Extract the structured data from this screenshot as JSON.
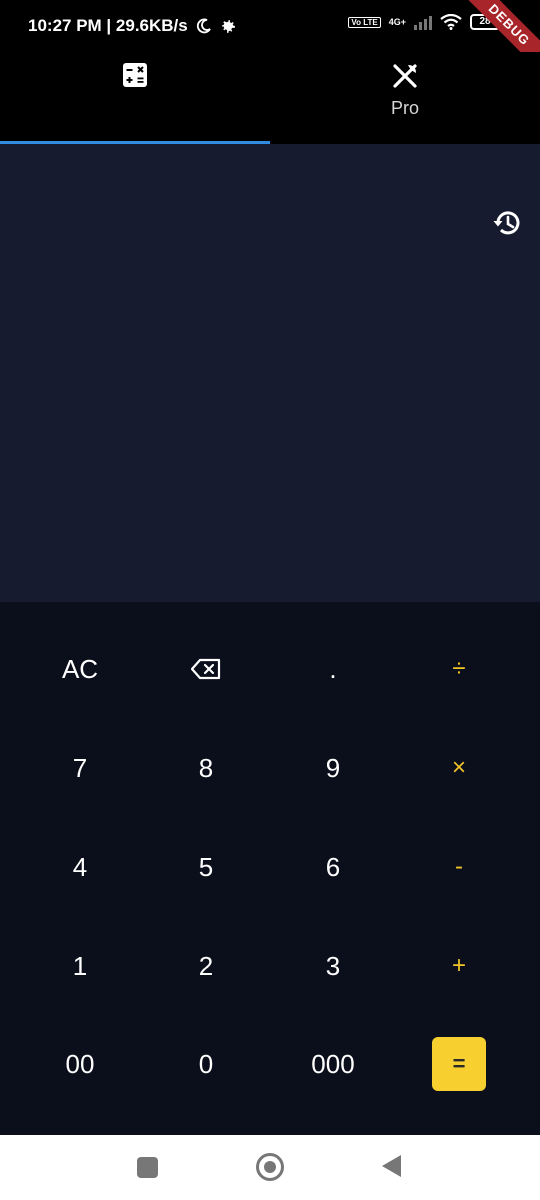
{
  "status_bar": {
    "time_speed": "10:27 PM | 29.6KB/s",
    "volte": "Vo LTE",
    "network": "4G+",
    "battery": "28",
    "debug_banner": "DEBUG"
  },
  "tabs": [
    {
      "icon": "calculator-icon",
      "label": "",
      "selected": true
    },
    {
      "icon": "fork-knife-icon",
      "label": "Pro",
      "selected": false
    }
  ],
  "display": {
    "expression": "",
    "result": "",
    "history_icon": "history-icon"
  },
  "keypad": {
    "row1": [
      "AC",
      "⌫",
      ".",
      "÷"
    ],
    "row2": [
      "7",
      "8",
      "9",
      "×"
    ],
    "row3": [
      "4",
      "5",
      "6",
      "-"
    ],
    "row4": [
      "1",
      "2",
      "3",
      "+"
    ],
    "row5": [
      "00",
      "0",
      "000",
      "="
    ]
  },
  "colors": {
    "accent": "#f2c428",
    "equals_bg": "#f7cf2e",
    "display_bg": "#161b30",
    "keypad_bg": "#0b0f1c",
    "tab_indicator": "#2f8ce0",
    "debug_ribbon": "#a8262a"
  },
  "nav_bar": {
    "recent": "recent-apps-icon",
    "home": "home-icon",
    "back": "back-icon"
  }
}
